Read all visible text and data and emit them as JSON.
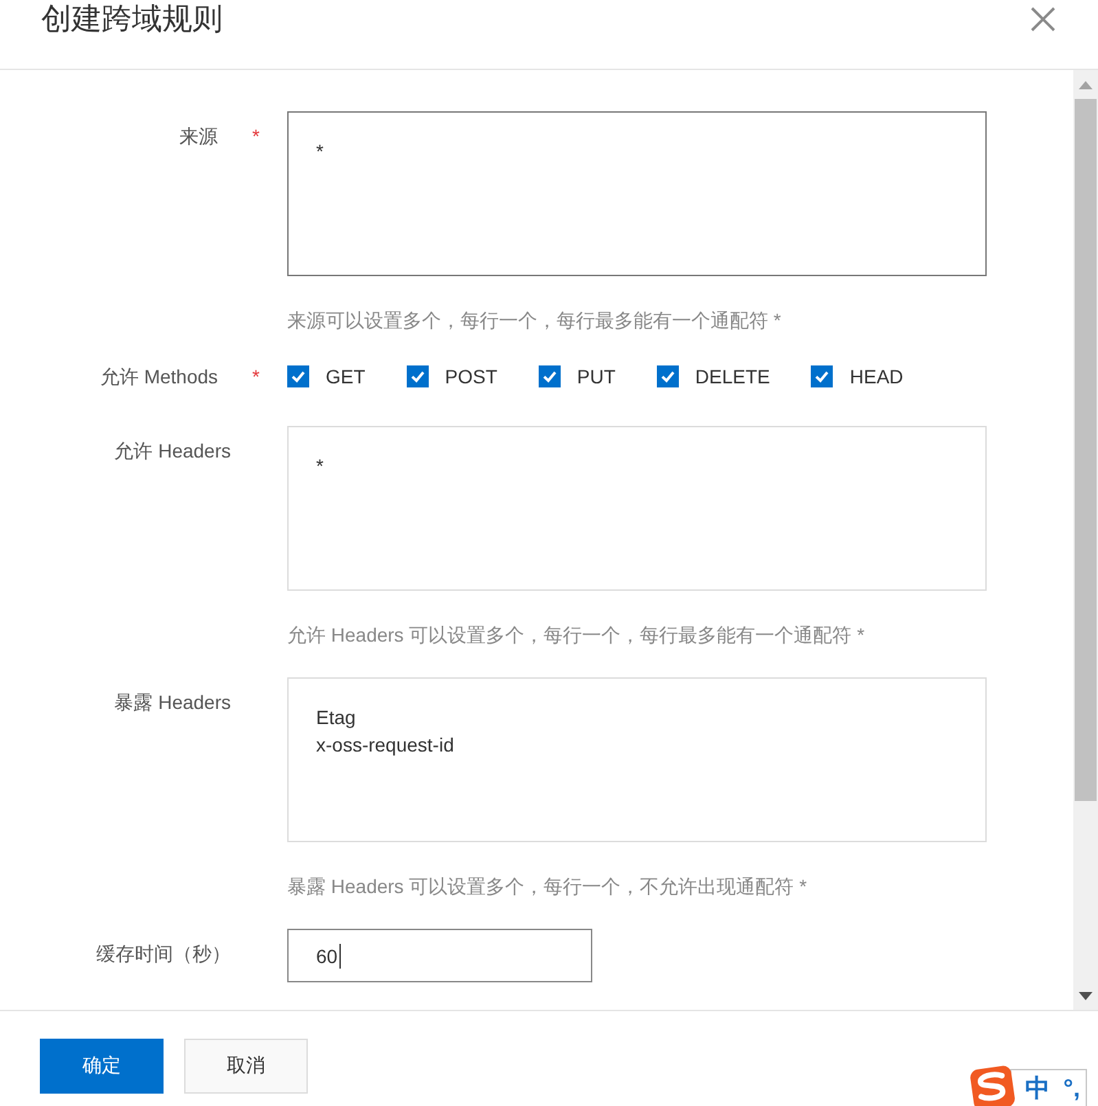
{
  "dialog": {
    "title": "创建跨域规则"
  },
  "form": {
    "fields": [
      {
        "kind": "textarea",
        "label": "来源",
        "required": true,
        "hovered": true,
        "focused": false,
        "value": "*",
        "hint": "来源可以设置多个，每行一个，每行最多能有一个通配符 *"
      },
      {
        "kind": "checkboxes",
        "label": "允许 Methods",
        "required": true,
        "options": [
          {
            "label": "GET",
            "checked": true
          },
          {
            "label": "POST",
            "checked": true
          },
          {
            "label": "PUT",
            "checked": true
          },
          {
            "label": "DELETE",
            "checked": true
          },
          {
            "label": "HEAD",
            "checked": true
          }
        ]
      },
      {
        "kind": "textarea",
        "label": "允许 Headers",
        "required": false,
        "hovered": false,
        "focused": false,
        "value": "*",
        "hint": "允许 Headers 可以设置多个，每行一个，每行最多能有一个通配符 *"
      },
      {
        "kind": "textarea",
        "label": "暴露 Headers",
        "required": false,
        "hovered": false,
        "focused": false,
        "value": "Etag\nx-oss-request-id",
        "hint": "暴露 Headers 可以设置多个，每行一个，不允许出现通配符 *"
      },
      {
        "kind": "input",
        "label": "缓存时间（秒）",
        "required": false,
        "hovered": false,
        "focused": true,
        "value": "60"
      }
    ]
  },
  "footer": {
    "buttons": [
      {
        "label": "确定",
        "kind": "primary"
      },
      {
        "label": "取消",
        "kind": "default"
      }
    ]
  },
  "ime": {
    "items": [
      "中",
      "°,"
    ]
  }
}
